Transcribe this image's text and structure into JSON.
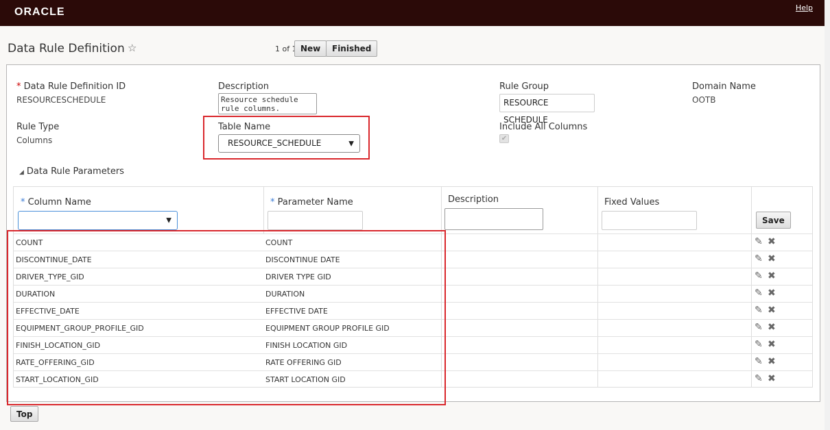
{
  "header": {
    "logo": "ORACLE",
    "help": "Help"
  },
  "page": {
    "title": "Data Rule Definition",
    "paging": "1 of 1",
    "new_label": "New",
    "finished_label": "Finished"
  },
  "form": {
    "id_label": "Data Rule Definition ID",
    "id_value": "RESOURCESCHEDULE",
    "desc_label": "Description",
    "desc_value": "Resource schedule rule columns.",
    "group_label": "Rule Group",
    "group_value": "RESOURCE SCHEDULE",
    "domain_label": "Domain Name",
    "domain_value": "OOTB",
    "type_label": "Rule Type",
    "type_value": "Columns",
    "table_label": "Table Name",
    "table_value": "RESOURCE_SCHEDULE",
    "include_label": "Include All Columns",
    "include_checked": true
  },
  "params": {
    "section_title": "Data Rule Parameters",
    "headers": {
      "column_name": "Column Name",
      "parameter_name": "Parameter Name",
      "description": "Description",
      "fixed_values": "Fixed Values"
    },
    "save_label": "Save",
    "rows": [
      {
        "column": "COUNT",
        "parameter": "COUNT"
      },
      {
        "column": "DISCONTINUE_DATE",
        "parameter": "DISCONTINUE DATE"
      },
      {
        "column": "DRIVER_TYPE_GID",
        "parameter": "DRIVER TYPE GID"
      },
      {
        "column": "DURATION",
        "parameter": "DURATION"
      },
      {
        "column": "EFFECTIVE_DATE",
        "parameter": "EFFECTIVE DATE"
      },
      {
        "column": "EQUIPMENT_GROUP_PROFILE_GID",
        "parameter": "EQUIPMENT GROUP PROFILE GID"
      },
      {
        "column": "FINISH_LOCATION_GID",
        "parameter": "FINISH LOCATION GID"
      },
      {
        "column": "RATE_OFFERING_GID",
        "parameter": "RATE OFFERING GID"
      },
      {
        "column": "START_LOCATION_GID",
        "parameter": "START LOCATION GID"
      }
    ]
  },
  "footer": {
    "top_label": "Top"
  },
  "colors": {
    "header_bg": "#2b0a08",
    "highlight": "#d9262b",
    "required": "#cc0000"
  }
}
